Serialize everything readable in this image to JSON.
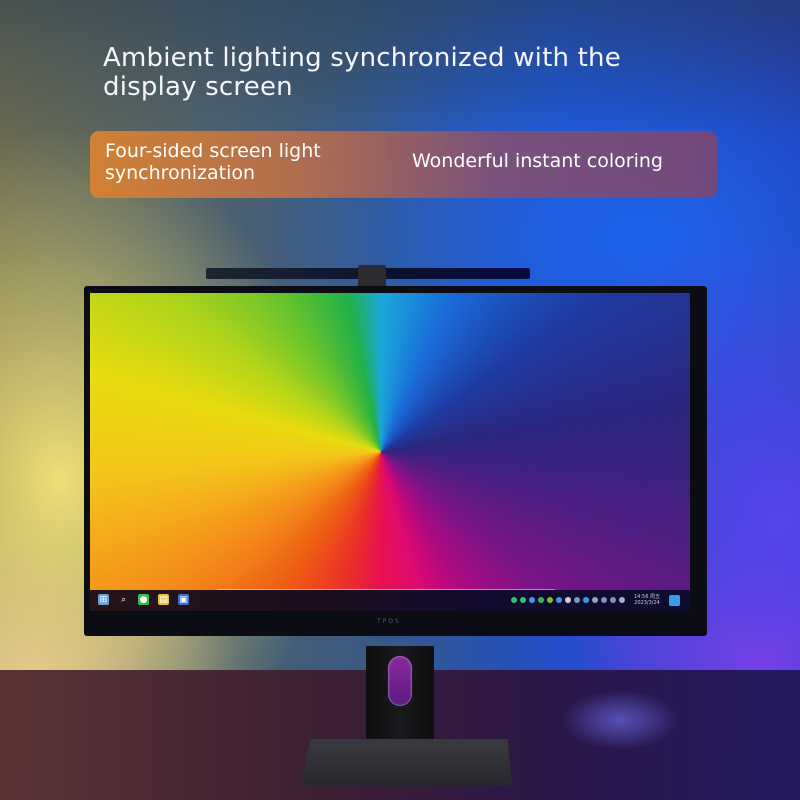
{
  "headline": "Ambient lighting synchronized with the display screen",
  "banner": {
    "left_text": "Four-sided screen light synchronization",
    "right_text": "Wonderful instant coloring"
  },
  "screen": {
    "dock_icons": [
      {
        "name": "safari",
        "glyph": "⊘",
        "color": "#2f8fe0"
      },
      {
        "name": "weibo",
        "glyph": "◉",
        "color": "#f0a020"
      },
      {
        "name": "photo-app",
        "glyph": "▲",
        "color": "#0a2040"
      },
      {
        "name": "evernote",
        "glyph": "❦",
        "color": "#3aa050"
      },
      {
        "name": "qq-browser",
        "glyph": "◎",
        "color": "#2a7ad8"
      },
      {
        "name": "star-app",
        "glyph": "★",
        "color": "#c040d8"
      },
      {
        "name": "pocket",
        "glyph": "♥",
        "color": "#f4f4f4"
      },
      {
        "name": "waves-app",
        "glyph": "≈",
        "color": "#f0c020"
      },
      {
        "name": "chrome",
        "glyph": "◍",
        "color": "#e8e8e8"
      },
      {
        "name": "folder",
        "glyph": "▬",
        "color": "#3a9ae8"
      },
      {
        "name": "reeder",
        "glyph": "★",
        "color": "#404040"
      },
      {
        "name": "butterfly-app",
        "glyph": "✦",
        "color": "#1a1a1a"
      },
      {
        "name": "messages",
        "glyph": "●",
        "color": "#30c050"
      },
      {
        "name": "music",
        "glyph": "♫",
        "color": "#f4f4f4"
      },
      {
        "name": "diamond-app",
        "glyph": "◆",
        "color": "#f4f4f4"
      },
      {
        "name": "info-app",
        "glyph": "!",
        "color": "#b070e0"
      }
    ],
    "taskbar_left": [
      {
        "name": "start",
        "glyph": "⊞",
        "color": "#6aa0e0"
      },
      {
        "name": "search",
        "glyph": "⌕",
        "color": "transparent"
      },
      {
        "name": "wechat",
        "glyph": "●",
        "color": "#30c050"
      },
      {
        "name": "file-explorer",
        "glyph": "▤",
        "color": "#e8c040"
      },
      {
        "name": "photos",
        "glyph": "▣",
        "color": "#3a70d0"
      }
    ],
    "tray_colors": [
      "#30c070",
      "#30c070",
      "#5090e0",
      "#40b060",
      "#80c030",
      "#3a9ae8",
      "#d0d0e0",
      "#8090c0",
      "#3a9ae8",
      "#a0a0c0",
      "#8090c0",
      "#8090c0",
      "#a0b0d0"
    ],
    "clock_time": "14:56 周五",
    "clock_date": "2023/3/24",
    "brand": "TPOS"
  }
}
